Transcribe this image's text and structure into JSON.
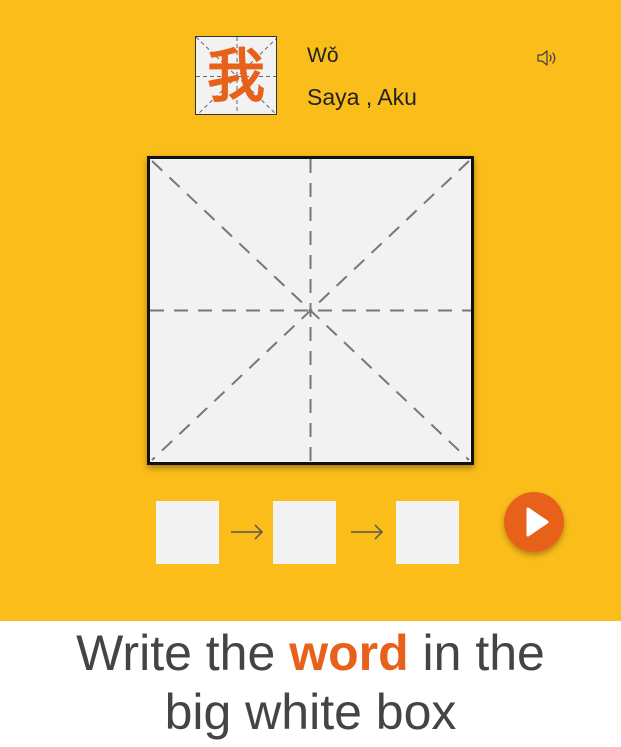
{
  "colors": {
    "background": "#FBBD1A",
    "accent": "#E8611A",
    "tile": "#f2f2f2",
    "text": "#222222",
    "instruction_text": "#444444"
  },
  "character": {
    "glyph": "我",
    "pinyin": "Wǒ",
    "meaning": "Saya , Aku"
  },
  "icons": {
    "speaker": "speaker-icon",
    "play": "play-icon",
    "arrow": "arrow-right-icon"
  },
  "instruction": {
    "part1": "Write the ",
    "highlight": "word",
    "part2": " in the",
    "line2": "big white box"
  }
}
